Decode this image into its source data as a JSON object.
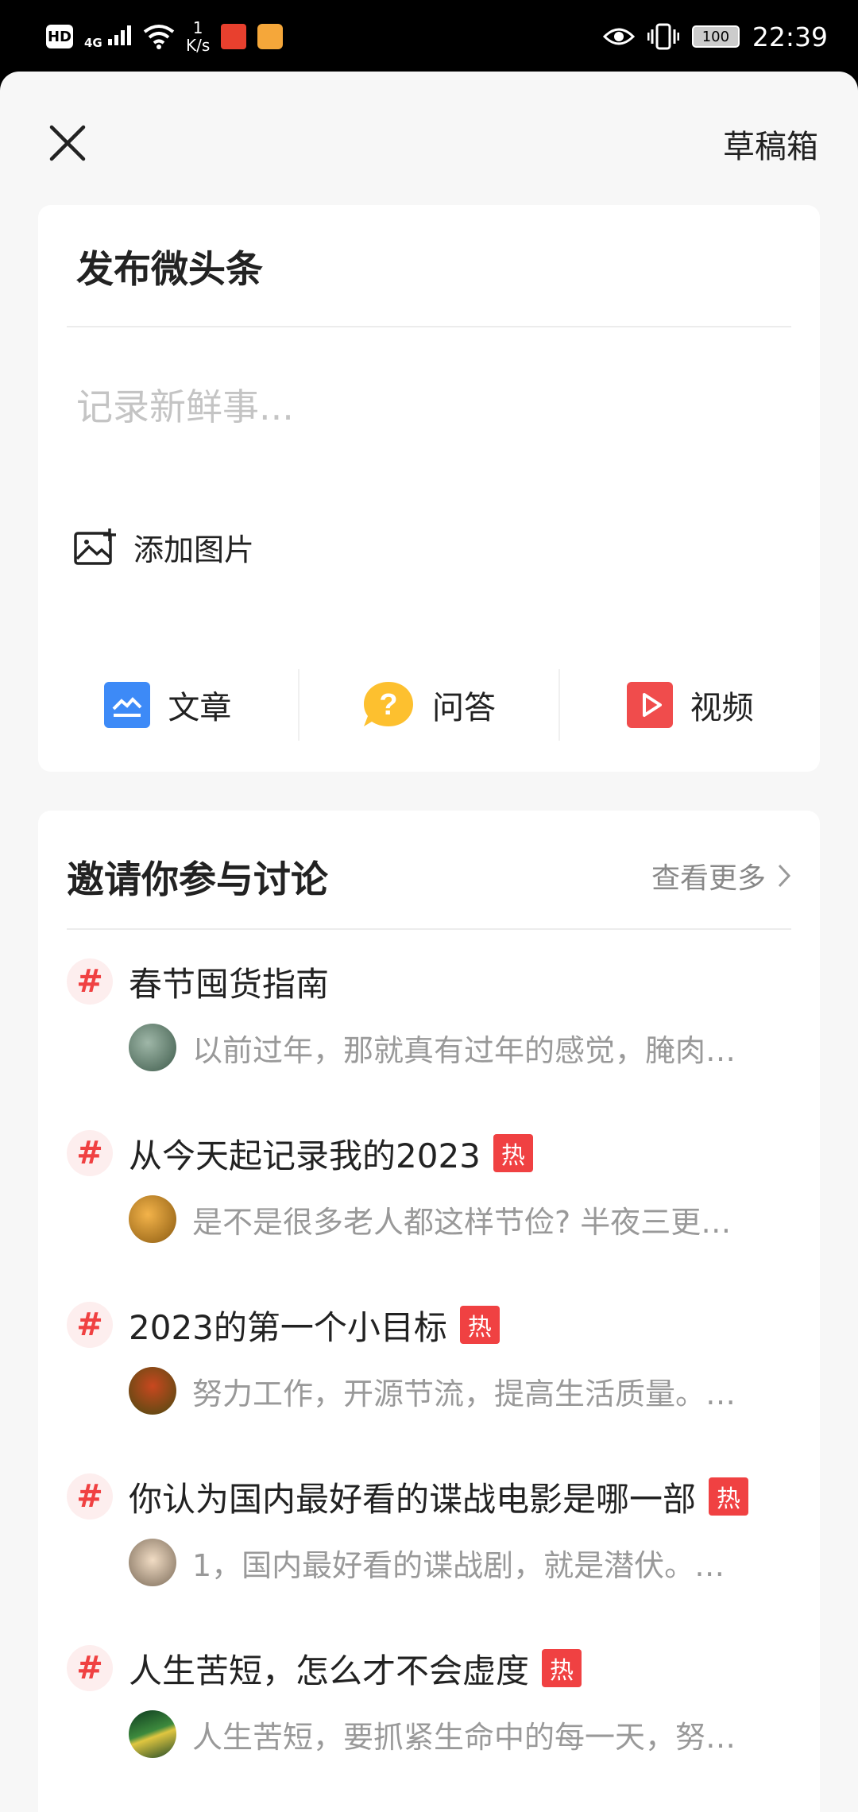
{
  "status_bar": {
    "hd": "HD",
    "network": "4G",
    "speed_value": "1",
    "speed_unit": "K/s",
    "battery": "100",
    "time": "22:39"
  },
  "header": {
    "close_icon": "close-icon",
    "drafts_label": "草稿箱"
  },
  "post": {
    "title": "发布微头条",
    "placeholder": "记录新鲜事...",
    "add_image_label": "添加图片",
    "add_image_icon": "image-plus-icon"
  },
  "post_types": [
    {
      "label": "文章",
      "icon": "article-icon",
      "color": "#3d8af7"
    },
    {
      "label": "问答",
      "icon": "question-icon",
      "color": "#fdc02f"
    },
    {
      "label": "视频",
      "icon": "video-icon",
      "color": "#f04c4c"
    }
  ],
  "discussion": {
    "title": "邀请你参与讨论",
    "more_label": "查看更多",
    "hot_label": "热",
    "topics": [
      {
        "title": "春节囤货指南",
        "hot": false,
        "excerpt": "以前过年，那就真有过年的感觉，腌肉…",
        "avatar_color": "#5a7a6a"
      },
      {
        "title": "从今天起记录我的2023",
        "hot": true,
        "excerpt": "是不是很多老人都这样节俭? 半夜三更…",
        "avatar_color": "#d8891f"
      },
      {
        "title": "2023的第一个小目标",
        "hot": true,
        "excerpt": "努力工作，开源节流，提高生活质量。…",
        "avatar_color": "#6b6a1f"
      },
      {
        "title": "你认为国内最好看的谍战电影是哪一部",
        "hot": true,
        "excerpt": "1，国内最好看的谍战剧，就是潜伏。…",
        "avatar_color": "#b7a38a"
      },
      {
        "title": "人生苦短，怎么才不会虚度",
        "hot": true,
        "excerpt": "人生苦短，要抓紧生命中的每一天，努…",
        "avatar_color": "#2e6b3a"
      }
    ]
  }
}
